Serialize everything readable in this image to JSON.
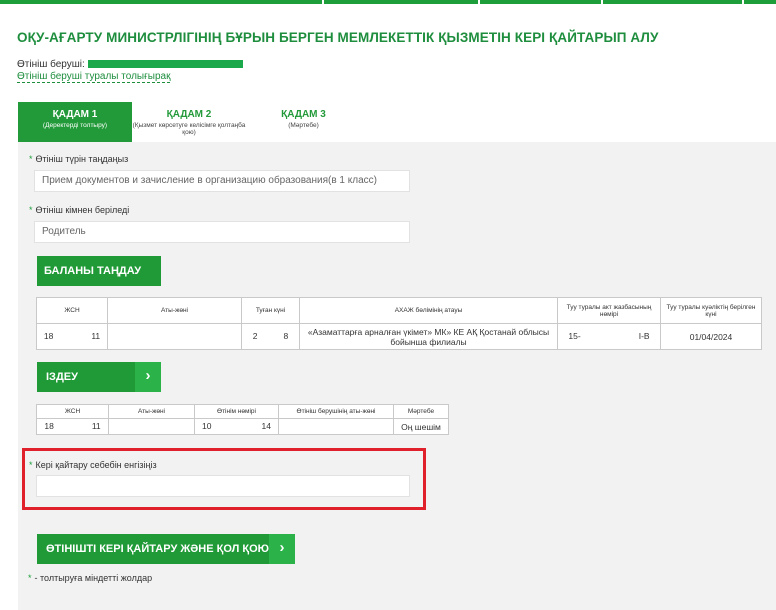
{
  "page": {
    "title": "ОҚУ-АҒАРТУ МИНИСТРЛІГІНІҢ БҰРЫН БЕРГЕН МЕМЛЕКЕТТІК ҚЫЗМЕТІН КЕРІ ҚАЙТАРЫП АЛУ",
    "applicant_label": "Өтініш беруші:",
    "applicant_more_link": "Өтініш беруші туралы толығырақ",
    "accent_color": "#1f9a37"
  },
  "tabs": [
    {
      "label": "ҚАДАМ 1",
      "sub": "(Деректерді толтыру)"
    },
    {
      "label": "ҚАДАМ 2",
      "sub": "(Қызмет көрсетуге келісімге қолтаңба қою)"
    },
    {
      "label": "ҚАДАМ 3",
      "sub": "(Мәртебе)"
    }
  ],
  "form": {
    "request_type": {
      "label": "Өтініш түрін таңдаңыз",
      "value": "Прием документов и зачисление в организацию образования(в 1 класс)"
    },
    "from_whom": {
      "label": "Өтініш кімнен беріледі",
      "value": "Родитель"
    },
    "select_child_button": "БАЛАНЫ ТАҢДАУ",
    "search_button": "ІЗДЕУ",
    "reason": {
      "label": "Кері қайтару себебін енгізіңіз",
      "value": ""
    },
    "submit_button": "ӨТІНІШТІ КЕРІ ҚАЙТАРУ ЖӘНЕ ҚОЛ ҚОЮ",
    "required_note": "- толтыруға міндетті жолдар",
    "required_mark": "*"
  },
  "child_table": {
    "headers": [
      "ЖСН",
      "Аты-жөні",
      "Туған күні",
      "АХАЖ бөлімінің атауы",
      "Туу туралы акт жазбасының нөмірі",
      "Туу туралы куәліктің берілген күні"
    ],
    "row": {
      "iin_start": "18",
      "iin_end": "11",
      "name": "",
      "birth_start": "2",
      "birth_end": "8",
      "registry_office": "«Азаматтарға арналған үкімет» МК» КЕ АҚ Қостанай облысы бойынша филиалы",
      "act_start": "15-",
      "act_end": "I-B",
      "cert_date": "01/04/2024"
    }
  },
  "result_table": {
    "headers": [
      "ЖСН",
      "Аты-жөні",
      "Өтінім нөмірі",
      "Өтініш берушінің аты-жөні",
      "Мәртебе"
    ],
    "row": {
      "iin_start": "18",
      "iin_end": "11",
      "name": "",
      "num_start": "10",
      "num_end": "14",
      "applicant_name": "",
      "status": "Оң шешім"
    }
  }
}
